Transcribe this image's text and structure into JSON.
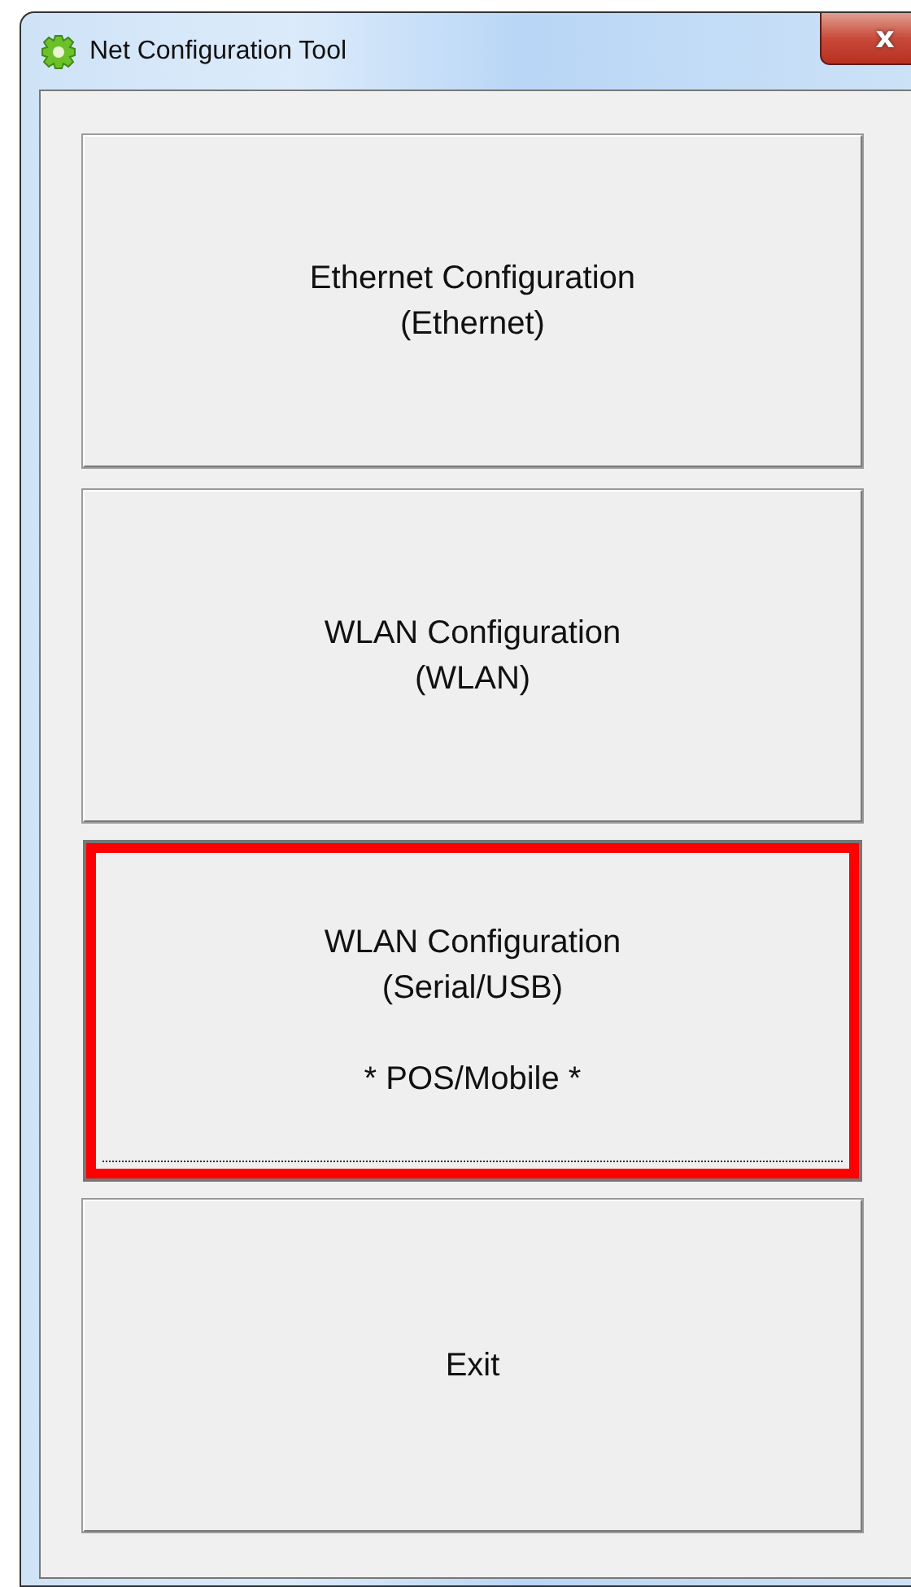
{
  "window": {
    "title": "Net Configuration Tool",
    "close_label": "x"
  },
  "buttons": [
    {
      "lines": [
        "Ethernet Configuration",
        "(Ethernet)"
      ],
      "highlighted": false,
      "focused": false
    },
    {
      "lines": [
        "WLAN Configuration",
        "(WLAN)"
      ],
      "highlighted": false,
      "focused": false
    },
    {
      "lines": [
        "WLAN Configuration",
        "(Serial/USB)"
      ],
      "note": "* POS/Mobile *",
      "highlighted": true,
      "focused": true
    },
    {
      "lines": [
        "Exit"
      ],
      "highlighted": false,
      "focused": false
    }
  ]
}
